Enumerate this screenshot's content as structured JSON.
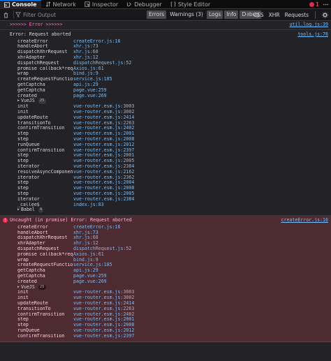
{
  "tabs": [
    {
      "label": "Console",
      "icon": "console-icon",
      "active": true
    },
    {
      "label": "Network",
      "icon": "network-icon",
      "active": false
    },
    {
      "label": "Inspector",
      "icon": "inspector-icon",
      "active": false
    },
    {
      "label": "Debugger",
      "icon": "debugger-icon",
      "active": false
    },
    {
      "label": "Style Editor",
      "icon": "style-editor-icon",
      "active": false
    }
  ],
  "error_badge": "1",
  "filter": {
    "placeholder": "Filter Output",
    "levels": [
      {
        "label": "Errors",
        "on": true
      },
      {
        "label": "Warnings (3)",
        "on": false
      },
      {
        "label": "Logs",
        "on": true
      },
      {
        "label": "Info",
        "on": true
      },
      {
        "label": "Debug",
        "on": true
      }
    ],
    "right": [
      "CSS",
      "XHR",
      "Requests"
    ]
  },
  "messages": [
    {
      "type": "log",
      "text": ">>>>>> Error >>>>>>",
      "location": "util.log.js:39"
    },
    {
      "type": "log",
      "text": "Error: Request aborted",
      "location": "tools.js:76",
      "frames1": [
        [
          "createError",
          "createError.js:16"
        ],
        [
          "handleAbort",
          "xhr.js:73"
        ],
        [
          "dispatchXhrRequest",
          "xhr.js:68"
        ],
        [
          "xhrAdapter",
          "xhr.js:12"
        ],
        [
          "dispatchRequest",
          "dispatchRequest.js:52"
        ],
        [
          "promise callback*request",
          "Axios.js:61"
        ],
        [
          "wrap",
          "bind.js:9"
        ],
        [
          "createRequestFunction",
          "service.js:185"
        ],
        [
          "getCaptcha",
          "api.js:29"
        ],
        [
          "getCaptcha",
          "page.vue:259"
        ],
        [
          "created",
          "page.vue:269"
        ]
      ],
      "group1": {
        "label": "VueJS",
        "count": "25"
      },
      "frames2": [
        [
          "init",
          "vue-router.esm.js:3003"
        ],
        [
          "init",
          "vue-router.esm.js:3002"
        ],
        [
          "updateRoute",
          "vue-router.esm.js:2414"
        ],
        [
          "transitionTo",
          "vue-router.esm.js:2263"
        ],
        [
          "confirmTransition",
          "vue-router.esm.js:2402"
        ],
        [
          "step",
          "vue-router.esm.js:2001"
        ],
        [
          "step",
          "vue-router.esm.js:2008"
        ],
        [
          "runQueue",
          "vue-router.esm.js:2012"
        ],
        [
          "confirmTransition",
          "vue-router.esm.js:2397"
        ],
        [
          "step",
          "vue-router.esm.js:2001"
        ],
        [
          "step",
          "vue-router.esm.js:2005"
        ],
        [
          "iterator",
          "vue-router.esm.js:2384"
        ],
        [
          "resolveAsyncComponents",
          "vue-router.esm.js:2162"
        ],
        [
          "iterator",
          "vue-router.esm.js:2362"
        ],
        [
          "step",
          "vue-router.esm.js:2004"
        ],
        [
          "step",
          "vue-router.esm.js:2008"
        ],
        [
          "step",
          "vue-router.esm.js:2005"
        ],
        [
          "iterator",
          "vue-router.esm.js:2384"
        ],
        [
          "_callee$",
          "index.js:83"
        ]
      ],
      "group2": {
        "label": "Babel",
        "count": "4"
      }
    },
    {
      "type": "error",
      "text": "Uncaught (in promise) Error: Request aborted",
      "location": "createError.js:16",
      "frames1": [
        [
          "createError",
          "createError.js:16"
        ],
        [
          "handleAbort",
          "xhr.js:73"
        ],
        [
          "dispatchXhrRequest",
          "xhr.js:68"
        ],
        [
          "xhrAdapter",
          "xhr.js:12"
        ],
        [
          "dispatchRequest",
          "dispatchRequest.js:52"
        ],
        [
          "promise callback*request",
          "Axios.js:61"
        ],
        [
          "wrap",
          "bind.js:9"
        ],
        [
          "createRequestFunction",
          "service.js:185"
        ],
        [
          "getCaptcha",
          "api.js:29"
        ],
        [
          "getCaptcha",
          "page.vue:259"
        ],
        [
          "created",
          "page.vue:269"
        ]
      ],
      "group1": {
        "label": "VueJS",
        "count": "25"
      },
      "frames2": [
        [
          "init",
          "vue-router.esm.js:3003"
        ],
        [
          "init",
          "vue-router.esm.js:3002"
        ],
        [
          "updateRoute",
          "vue-router.esm.js:2414"
        ],
        [
          "transitionTo",
          "vue-router.esm.js:2263"
        ],
        [
          "confirmTransition",
          "vue-router.esm.js:2402"
        ],
        [
          "step",
          "vue-router.esm.js:2001"
        ],
        [
          "step",
          "vue-router.esm.js:2008"
        ],
        [
          "runQueue",
          "vue-router.esm.js:2012"
        ],
        [
          "confirmTransition",
          "vue-router.esm.js:2397"
        ]
      ]
    }
  ]
}
